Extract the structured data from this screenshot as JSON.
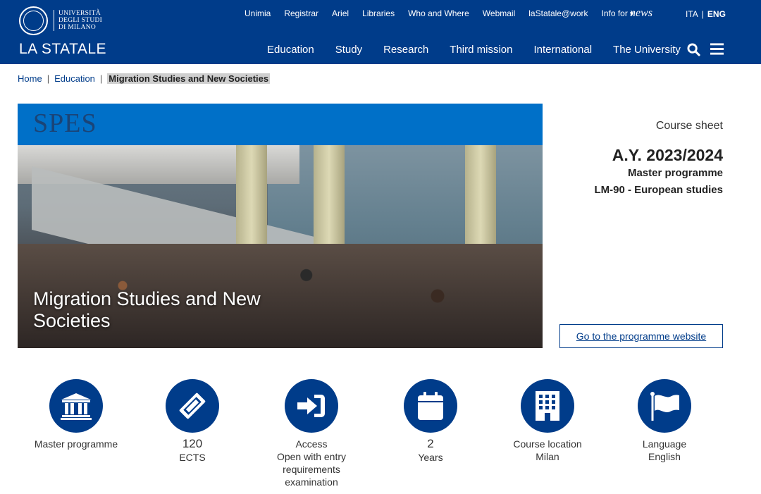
{
  "logo": {
    "lines": [
      "UNIVERSITÀ",
      "DEGLI STUDI",
      "DI MILANO"
    ],
    "brand": "LA STATALE"
  },
  "util_nav": [
    "Unimia",
    "Registrar",
    "Ariel",
    "Libraries",
    "Who and Where",
    "Webmail",
    "laStatale@work",
    "Info for"
  ],
  "news": "news",
  "lang": {
    "ita": "ITA",
    "sep": "|",
    "eng": "ENG"
  },
  "main_nav": [
    "Education",
    "Study",
    "Research",
    "Third mission",
    "International",
    "The University"
  ],
  "breadcrumb": {
    "home": "Home",
    "education": "Education",
    "current": "Migration Studies and New Societies",
    "sep": "|"
  },
  "hero": {
    "tag": "SPES",
    "title": "Migration Studies and New Societies"
  },
  "sheet": {
    "label": "Course sheet",
    "year": "A.Y. 2023/2024",
    "degree": "Master programme",
    "class": "LM-90 - European studies",
    "button": "Go to the programme website"
  },
  "features": [
    {
      "icon": "institution-icon",
      "line1": "Master programme",
      "line2": "",
      "line3": ""
    },
    {
      "icon": "ticket-icon",
      "line1": "120",
      "line2": "ECTS",
      "line3": ""
    },
    {
      "icon": "sign-in-icon",
      "line1": "Access",
      "line2": "Open with entry",
      "line3": "requirements examination"
    },
    {
      "icon": "calendar-icon",
      "line1": "2",
      "line2": "Years",
      "line3": ""
    },
    {
      "icon": "building-icon",
      "line1": "Course location",
      "line2": "Milan",
      "line3": ""
    },
    {
      "icon": "flag-icon",
      "line1": "Language",
      "line2": "English",
      "line3": ""
    }
  ],
  "colors": {
    "primary": "#003c8a",
    "accent": "#0070c8"
  }
}
